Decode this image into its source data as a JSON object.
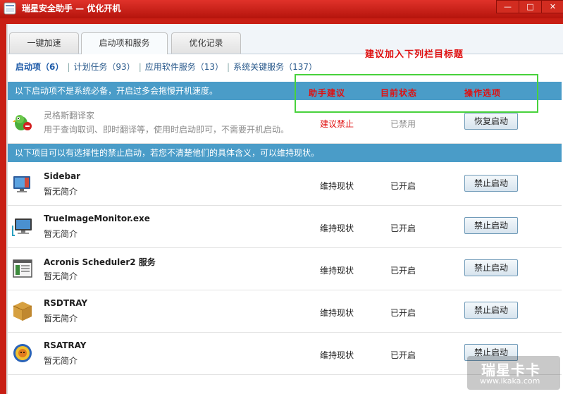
{
  "window": {
    "title": "瑞星安全助手 — 优化开机",
    "buttons": [
      "—",
      "□",
      "✕"
    ]
  },
  "tabs": [
    {
      "label": "一键加速"
    },
    {
      "label": "启动项和服务"
    },
    {
      "label": "优化记录"
    }
  ],
  "categories": [
    {
      "label": "启动项（6）"
    },
    {
      "label": "计划任务（93）"
    },
    {
      "label": "应用软件服务（13）"
    },
    {
      "label": "系统关键服务（137）"
    }
  ],
  "annotation": {
    "suggest_text": "建议加入下列栏目标题",
    "col_advice": "助手建议",
    "col_status": "目前状态",
    "col_action": "操作选项"
  },
  "section1": {
    "text": "以下启动项不是系统必备，开启过多会拖慢开机速度。"
  },
  "section2": {
    "text": "以下项目可以有选择性的禁止启动，若您不清楚他们的具体含义，可以维持现状。"
  },
  "rows": [
    {
      "name": "灵格斯翻译家",
      "desc": "用于查询取词、即时翻译等，使用时启动即可，不需要开机启动。",
      "advice": "建议禁止",
      "status": "已禁用",
      "action": "恢复启动",
      "icon": "lingoes-parrot-icon"
    },
    {
      "name": "Sidebar",
      "desc": "暂无简介",
      "advice": "维持现状",
      "status": "已开启",
      "action": "禁止启动",
      "icon": "sidebar-monitor-icon"
    },
    {
      "name": "TrueImageMonitor.exe",
      "desc": "暂无简介",
      "advice": "维持现状",
      "status": "已开启",
      "action": "禁止启动",
      "icon": "computer-monitor-icon"
    },
    {
      "name": "Acronis Scheduler2 服务",
      "desc": "暂无简介",
      "advice": "维持现状",
      "status": "已开启",
      "action": "禁止启动",
      "icon": "window-app-icon"
    },
    {
      "name": "RSDTRAY",
      "desc": "暂无简介",
      "advice": "维持现状",
      "status": "已开启",
      "action": "禁止启动",
      "icon": "box-icon"
    },
    {
      "name": "RSATRAY",
      "desc": "暂无简介",
      "advice": "维持现状",
      "status": "已开启",
      "action": "禁止启动",
      "icon": "rising-lion-icon"
    }
  ],
  "watermark": {
    "line1": "瑞星卡卡",
    "line2": "www.ikaka.com"
  },
  "colors": {
    "accent": "#4a9cc8",
    "title_red": "#c81e14",
    "annotation_red": "#e01010",
    "highlight_green": "#48d23c"
  }
}
